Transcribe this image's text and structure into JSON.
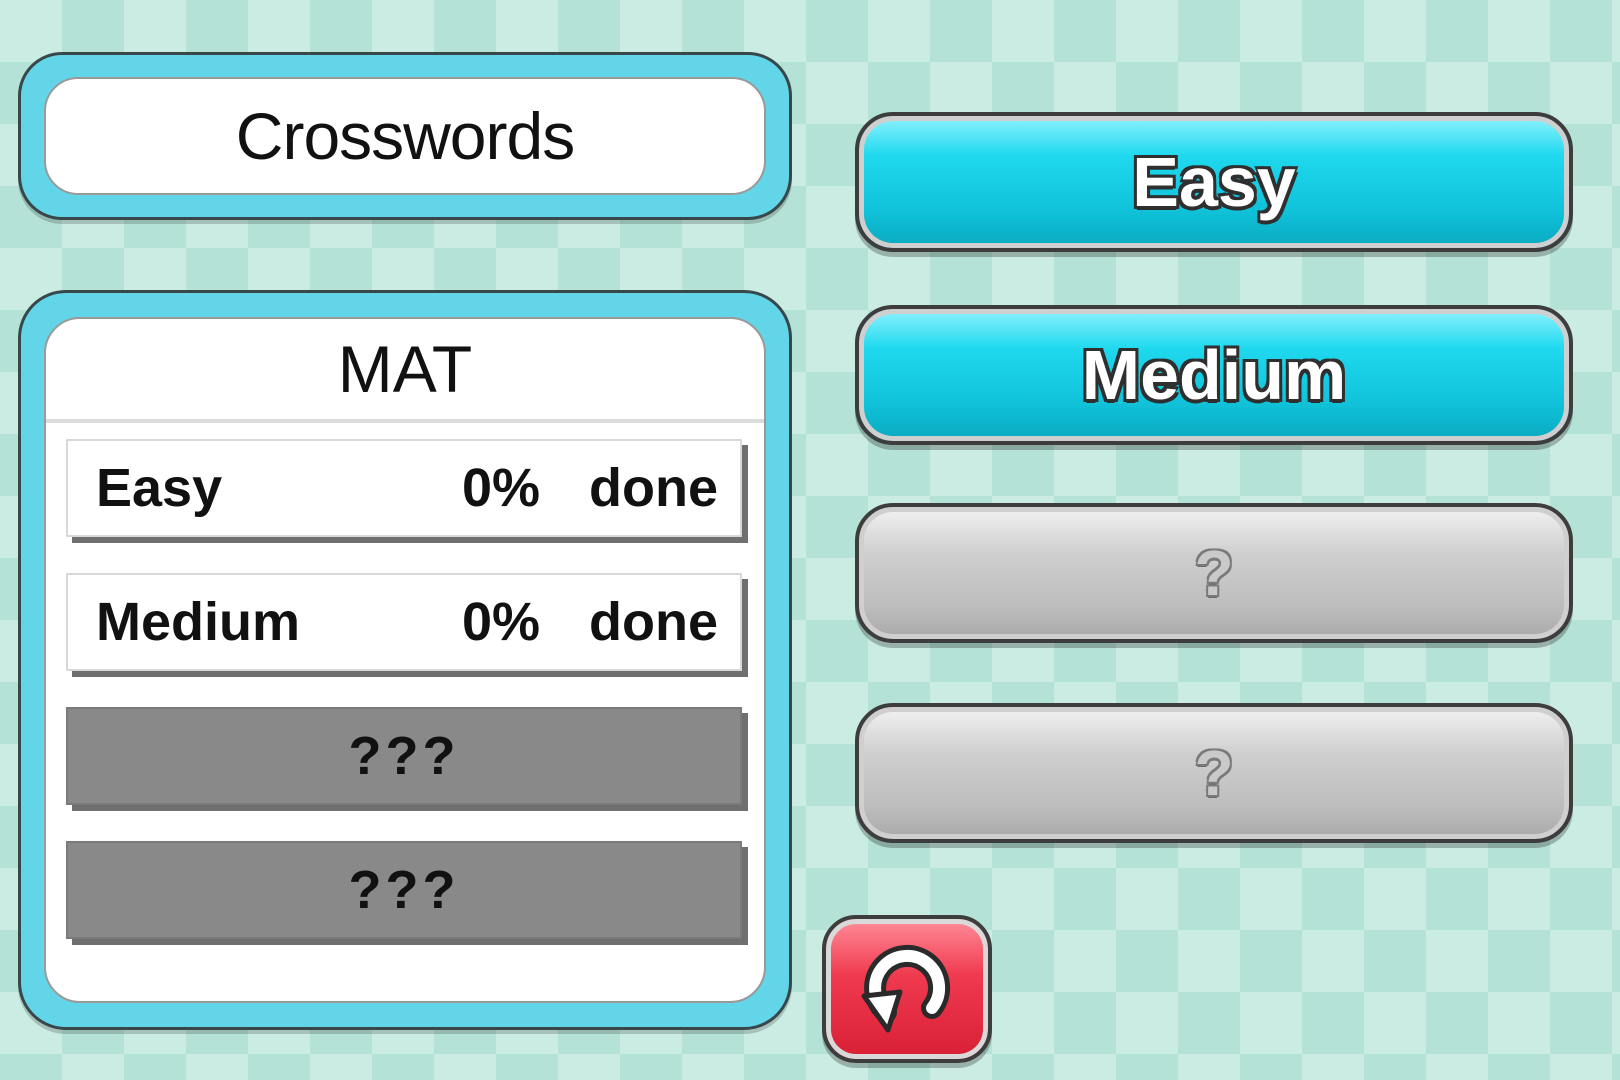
{
  "title": "Crosswords",
  "progress_panel": {
    "category": "MAT",
    "rows": [
      {
        "label": "Easy",
        "percent": "0%",
        "status": "done"
      },
      {
        "label": "Medium",
        "percent": "0%",
        "status": "done"
      },
      {
        "label": "???"
      },
      {
        "label": "???"
      }
    ]
  },
  "difficulty_buttons": [
    {
      "label": "Easy",
      "state": "unlocked"
    },
    {
      "label": "Medium",
      "state": "unlocked"
    },
    {
      "label": "?",
      "state": "locked"
    },
    {
      "label": "?",
      "state": "locked"
    }
  ],
  "back_button": {
    "icon": "back-arrow-icon",
    "color": "#e8273d"
  },
  "colors": {
    "accent": "#62d5e8",
    "button_active": "#1fd9ee",
    "button_locked": "#bdbdbd"
  }
}
